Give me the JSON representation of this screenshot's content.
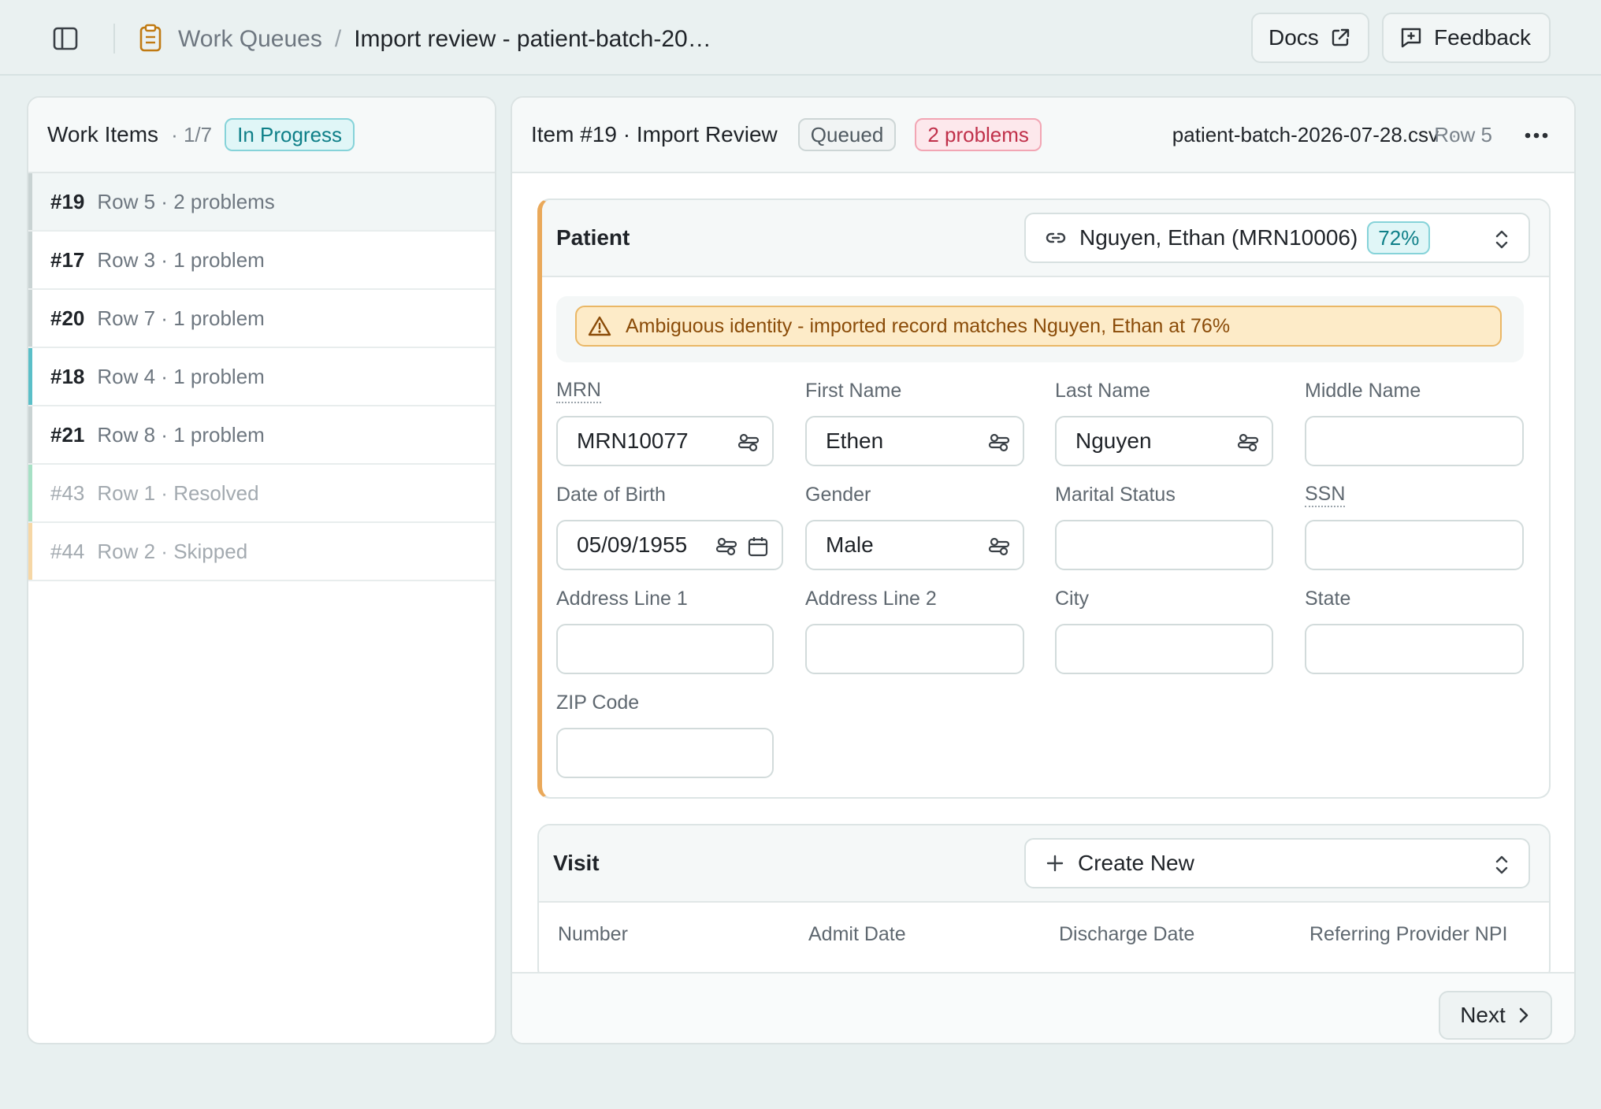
{
  "breadcrumb": {
    "root": "Work Queues",
    "separator": "/",
    "current": "Import review - patient-batch-20…"
  },
  "topbar": {
    "docs_label": "Docs",
    "feedback_label": "Feedback"
  },
  "work_items": {
    "title": "Work Items",
    "count": "· 1/7",
    "status": "In Progress",
    "items": [
      {
        "num": "#19",
        "sub": "Row 5 · 2 problems",
        "bar": "#c9d3d3",
        "active": true,
        "dim": false
      },
      {
        "num": "#17",
        "sub": "Row 3 · 1 problem",
        "bar": "#c9d3d3",
        "active": false,
        "dim": false
      },
      {
        "num": "#20",
        "sub": "Row 7 · 1 problem",
        "bar": "#c9d3d3",
        "active": false,
        "dim": false
      },
      {
        "num": "#18",
        "sub": "Row 4 · 1 problem",
        "bar": "#5bbfc8",
        "active": false,
        "dim": false
      },
      {
        "num": "#21",
        "sub": "Row 8 · 1 problem",
        "bar": "#c9d3d3",
        "active": false,
        "dim": false
      },
      {
        "num": "#43",
        "sub": "Row 1 · Resolved",
        "bar": "#a7e0c5",
        "active": false,
        "dim": true
      },
      {
        "num": "#44",
        "sub": "Row 2 · Skipped",
        "bar": "#f6d7a6",
        "active": false,
        "dim": true
      }
    ]
  },
  "item": {
    "title": "Item #19 · Import Review",
    "status": "Queued",
    "problems": "2 problems",
    "file": "patient-batch-2026-07-28.csv",
    "dot": "·",
    "row": "Row 5"
  },
  "patient": {
    "title": "Patient",
    "match_name": "Nguyen, Ethan (MRN10006)",
    "match_pct": "72%",
    "alert": "Ambiguous identity - imported record matches Nguyen, Ethan at 76%",
    "fields": {
      "mrn": {
        "label": "MRN",
        "value": "MRN10077"
      },
      "first_name": {
        "label": "First Name",
        "value": "Ethen"
      },
      "last_name": {
        "label": "Last Name",
        "value": "Nguyen"
      },
      "middle_name": {
        "label": "Middle Name",
        "value": ""
      },
      "dob": {
        "label": "Date of Birth",
        "value": "05/09/1955"
      },
      "gender": {
        "label": "Gender",
        "value": "Male"
      },
      "marital": {
        "label": "Marital Status",
        "value": ""
      },
      "ssn": {
        "label": "SSN",
        "value": ""
      },
      "addr1": {
        "label": "Address Line 1",
        "value": ""
      },
      "addr2": {
        "label": "Address Line 2",
        "value": ""
      },
      "city": {
        "label": "City",
        "value": ""
      },
      "state": {
        "label": "State",
        "value": ""
      },
      "zip": {
        "label": "ZIP Code",
        "value": ""
      }
    }
  },
  "visit": {
    "title": "Visit",
    "selector": "Create New",
    "columns": [
      "Number",
      "Admit Date",
      "Discharge Date",
      "Referring Provider NPI"
    ]
  },
  "footer": {
    "next_label": "Next"
  },
  "colors": {
    "accent": "#0e7f88",
    "warning": "#eaa95a",
    "danger": "#c0304a"
  }
}
